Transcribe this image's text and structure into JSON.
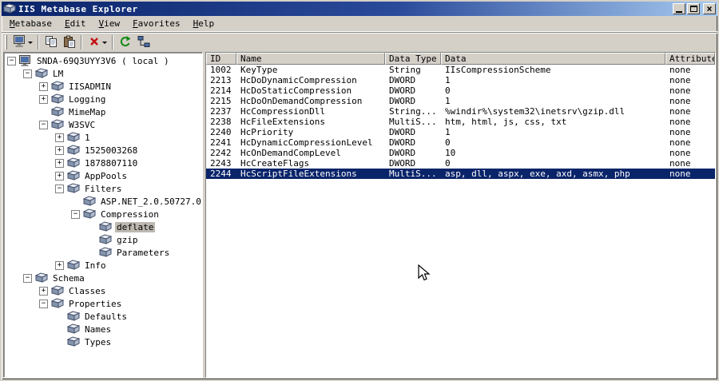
{
  "window": {
    "title": "IIS Metabase Explorer",
    "controls": [
      {
        "name": "minimize"
      },
      {
        "name": "maximize"
      },
      {
        "name": "close"
      }
    ]
  },
  "colors": {
    "window_bg": "#d4d0c8",
    "titlebar_start": "#0a246a",
    "titlebar_end": "#a6caf0",
    "selection_bg": "#0a246a",
    "selection_text": "#ffffff",
    "tree_inactive_selection": "#bdb9b1",
    "delete_icon_red": "#c41010"
  },
  "menu": {
    "items": [
      {
        "label": "Metabase",
        "accel": 0
      },
      {
        "label": "Edit",
        "accel": 0
      },
      {
        "label": "View",
        "accel": 0
      },
      {
        "label": "Favorites",
        "accel": 0
      },
      {
        "label": "Help",
        "accel": 0
      }
    ]
  },
  "toolbar": {
    "buttons": [
      {
        "name": "connect-server-button",
        "icon": "server-icon",
        "caret": true
      },
      {
        "sep": true
      },
      {
        "name": "copy-button",
        "icon": "copy-icon"
      },
      {
        "name": "paste-button",
        "icon": "paste-icon"
      },
      {
        "sep": true
      },
      {
        "name": "delete-button",
        "icon": "delete-icon",
        "caret": true
      },
      {
        "sep": true
      },
      {
        "name": "refresh-button",
        "icon": "refresh-icon"
      },
      {
        "name": "network-button",
        "icon": "network-icon"
      }
    ]
  },
  "tree": {
    "nodes": [
      {
        "depth": 0,
        "expander": "open",
        "icon": "computer",
        "label": "SNDA-69Q3UYY3V6 ( local )"
      },
      {
        "depth": 1,
        "expander": "open",
        "icon": "key",
        "label": "LM"
      },
      {
        "depth": 2,
        "expander": "closed",
        "icon": "key",
        "label": "IISADMIN"
      },
      {
        "depth": 2,
        "expander": "closed",
        "icon": "key",
        "label": "Logging"
      },
      {
        "depth": 2,
        "expander": "none",
        "icon": "key",
        "label": "MimeMap"
      },
      {
        "depth": 2,
        "expander": "open",
        "icon": "key",
        "label": "W3SVC"
      },
      {
        "depth": 3,
        "expander": "closed",
        "icon": "key",
        "label": "1"
      },
      {
        "depth": 3,
        "expander": "closed",
        "icon": "key",
        "label": "1525003268"
      },
      {
        "depth": 3,
        "expander": "closed",
        "icon": "key",
        "label": "1878807110"
      },
      {
        "depth": 3,
        "expander": "closed",
        "icon": "key",
        "label": "AppPools"
      },
      {
        "depth": 3,
        "expander": "open",
        "icon": "key",
        "label": "Filters"
      },
      {
        "depth": 4,
        "expander": "none",
        "icon": "key",
        "label": "ASP.NET_2.0.50727.0"
      },
      {
        "depth": 4,
        "expander": "open",
        "icon": "key",
        "label": "Compression"
      },
      {
        "depth": 5,
        "expander": "none",
        "icon": "key",
        "label": "deflate",
        "selected": true
      },
      {
        "depth": 5,
        "expander": "none",
        "icon": "key",
        "label": "gzip"
      },
      {
        "depth": 5,
        "expander": "none",
        "icon": "key",
        "label": "Parameters"
      },
      {
        "depth": 3,
        "expander": "closed",
        "icon": "key",
        "label": "Info"
      },
      {
        "depth": 1,
        "expander": "open",
        "icon": "key",
        "label": "Schema"
      },
      {
        "depth": 2,
        "expander": "closed",
        "icon": "key",
        "label": "Classes"
      },
      {
        "depth": 2,
        "expander": "open",
        "icon": "key",
        "label": "Properties"
      },
      {
        "depth": 3,
        "expander": "none",
        "icon": "key",
        "label": "Defaults"
      },
      {
        "depth": 3,
        "expander": "none",
        "icon": "key",
        "label": "Names"
      },
      {
        "depth": 3,
        "expander": "none",
        "icon": "key",
        "label": "Types"
      }
    ]
  },
  "table": {
    "columns": [
      "ID",
      "Name",
      "Data Type",
      "Data",
      "Attributes"
    ],
    "rows": [
      [
        "1002",
        "KeyType",
        "String",
        "IIsCompressionScheme",
        "none"
      ],
      [
        "2213",
        "HcDoDynamicCompression",
        "DWORD",
        "1",
        "none"
      ],
      [
        "2214",
        "HcDoStaticCompression",
        "DWORD",
        "0",
        "none"
      ],
      [
        "2215",
        "HcDoOnDemandCompression",
        "DWORD",
        "1",
        "none"
      ],
      [
        "2237",
        "HcCompressionDll",
        "String...",
        "%windir%\\system32\\inetsrv\\gzip.dll",
        "none"
      ],
      [
        "2238",
        "HcFileExtensions",
        "MultiS...",
        "htm, html, js, css, txt",
        "none"
      ],
      [
        "2240",
        "HcPriority",
        "DWORD",
        "1",
        "none"
      ],
      [
        "2241",
        "HcDynamicCompressionLevel",
        "DWORD",
        "0",
        "none"
      ],
      [
        "2242",
        "HcOnDemandCompLevel",
        "DWORD",
        "10",
        "none"
      ],
      [
        "2243",
        "HcCreateFlags",
        "DWORD",
        "0",
        "none"
      ],
      [
        "2244",
        "HcScriptFileExtensions",
        "MultiS...",
        "asp, dll, aspx, exe, axd, asmx, php",
        "none"
      ]
    ],
    "selected_id": "2244"
  }
}
